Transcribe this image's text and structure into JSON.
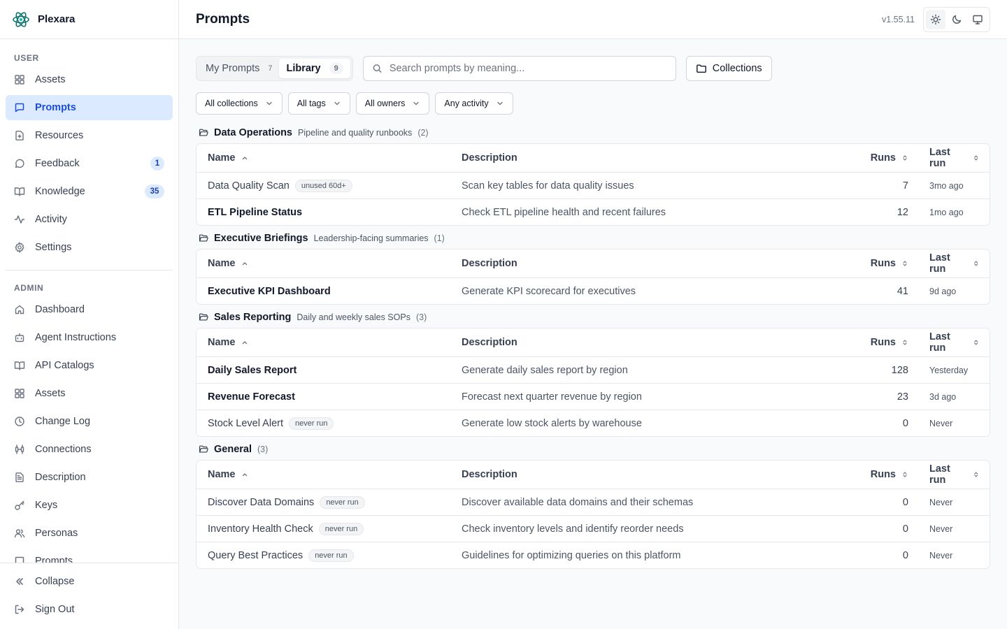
{
  "app": {
    "name": "Plexara",
    "version": "v1.55.11",
    "accent": "#1d4ed8"
  },
  "sidebar": {
    "user_label": "USER",
    "user_items": [
      {
        "label": "Assets",
        "icon": "grid-icon"
      },
      {
        "label": "Prompts",
        "icon": "message-square-icon",
        "active": true
      },
      {
        "label": "Resources",
        "icon": "file-plus-icon"
      },
      {
        "label": "Feedback",
        "icon": "message-circle-icon",
        "badge": "1"
      },
      {
        "label": "Knowledge",
        "icon": "book-open-icon",
        "badge": "35"
      },
      {
        "label": "Activity",
        "icon": "activity-icon"
      },
      {
        "label": "Settings",
        "icon": "gear-icon"
      }
    ],
    "admin_label": "ADMIN",
    "admin_items": [
      {
        "label": "Dashboard",
        "icon": "home-icon"
      },
      {
        "label": "Agent Instructions",
        "icon": "bot-icon"
      },
      {
        "label": "API Catalogs",
        "icon": "book-open-icon"
      },
      {
        "label": "Assets",
        "icon": "grid-icon"
      },
      {
        "label": "Change Log",
        "icon": "clock-icon"
      },
      {
        "label": "Connections",
        "icon": "cable-icon"
      },
      {
        "label": "Description",
        "icon": "file-text-icon"
      },
      {
        "label": "Keys",
        "icon": "key-icon"
      },
      {
        "label": "Personas",
        "icon": "users-icon"
      },
      {
        "label": "Prompts",
        "icon": "message-square-icon"
      }
    ],
    "footer": {
      "collapse": "Collapse",
      "sign_out": "Sign Out"
    }
  },
  "header": {
    "title": "Prompts"
  },
  "tabs": [
    {
      "label": "My Prompts",
      "count": "7"
    },
    {
      "label": "Library",
      "count": "9",
      "active": true
    }
  ],
  "search": {
    "placeholder": "Search prompts by meaning..."
  },
  "collections_button": "Collections",
  "filters": [
    "All collections",
    "All tags",
    "All owners",
    "Any activity"
  ],
  "columns": {
    "name": "Name",
    "description": "Description",
    "runs": "Runs",
    "last_run": "Last run"
  },
  "groups": [
    {
      "title": "Data Operations",
      "subtitle": "Pipeline and quality runbooks",
      "count": "(2)",
      "rows": [
        {
          "name": "Data Quality Scan",
          "tag": "unused 60d+",
          "description": "Scan key tables for data quality issues",
          "runs": "7",
          "last_run": "3mo ago"
        },
        {
          "name": "ETL Pipeline Status",
          "tag": "",
          "description": "Check ETL pipeline health and recent failures",
          "runs": "12",
          "last_run": "1mo ago"
        }
      ]
    },
    {
      "title": "Executive Briefings",
      "subtitle": "Leadership-facing summaries",
      "count": "(1)",
      "rows": [
        {
          "name": "Executive KPI Dashboard",
          "tag": "",
          "description": "Generate KPI scorecard for executives",
          "runs": "41",
          "last_run": "9d ago"
        }
      ]
    },
    {
      "title": "Sales Reporting",
      "subtitle": "Daily and weekly sales SOPs",
      "count": "(3)",
      "rows": [
        {
          "name": "Daily Sales Report",
          "tag": "",
          "description": "Generate daily sales report by region",
          "runs": "128",
          "last_run": "Yesterday"
        },
        {
          "name": "Revenue Forecast",
          "tag": "",
          "description": "Forecast next quarter revenue by region",
          "runs": "23",
          "last_run": "3d ago"
        },
        {
          "name": "Stock Level Alert",
          "tag": "never run",
          "description": "Generate low stock alerts by warehouse",
          "runs": "0",
          "last_run": "Never"
        }
      ]
    },
    {
      "title": "General",
      "subtitle": "",
      "count": "(3)",
      "rows": [
        {
          "name": "Discover Data Domains",
          "tag": "never run",
          "description": "Discover available data domains and their schemas",
          "runs": "0",
          "last_run": "Never"
        },
        {
          "name": "Inventory Health Check",
          "tag": "never run",
          "description": "Check inventory levels and identify reorder needs",
          "runs": "0",
          "last_run": "Never"
        },
        {
          "name": "Query Best Practices",
          "tag": "never run",
          "description": "Guidelines for optimizing queries on this platform",
          "runs": "0",
          "last_run": "Never"
        }
      ]
    }
  ]
}
